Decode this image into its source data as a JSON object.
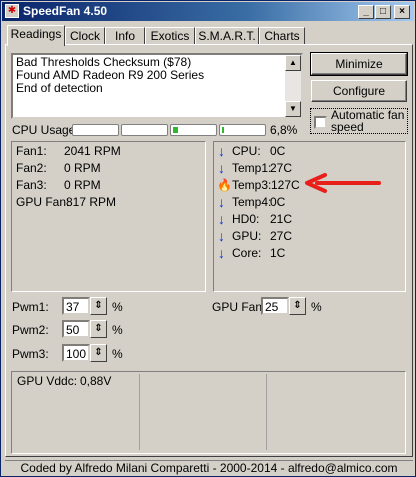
{
  "window": {
    "title": "SpeedFan 4.50",
    "minimize": "_",
    "maximize": "□",
    "close": "×"
  },
  "tabs": [
    {
      "label": "Readings"
    },
    {
      "label": "Clock"
    },
    {
      "label": "Info"
    },
    {
      "label": "Exotics"
    },
    {
      "label": "S.M.A.R.T."
    },
    {
      "label": "Charts"
    }
  ],
  "log": {
    "lines": [
      "Bad Thresholds Checksum ($78)",
      "Found AMD Radeon R9 200 Series",
      "End of detection"
    ]
  },
  "buttons": {
    "minimize": "Minimize",
    "configure": "Configure"
  },
  "auto_fan": {
    "label_line1": "Automatic fan",
    "label_line2": "speed",
    "checked": false
  },
  "cpu": {
    "label": "CPU Usage",
    "percent": "6,8%",
    "cores": [
      0,
      0,
      0.12,
      0.05
    ]
  },
  "fans": [
    {
      "label": "Fan1:",
      "value": "2041 RPM"
    },
    {
      "label": "Fan2:",
      "value": "0 RPM"
    },
    {
      "label": "Fan3:",
      "value": "0 RPM"
    },
    {
      "label": "GPU Fan:",
      "value": "817 RPM"
    }
  ],
  "temps": [
    {
      "label": "CPU:",
      "value": "0C",
      "icon": "arrow-down-icon"
    },
    {
      "label": "Temp1:",
      "value": "27C",
      "icon": "arrow-down-icon"
    },
    {
      "label": "Temp3:",
      "value": "127C",
      "icon": "flame-icon"
    },
    {
      "label": "Temp4:",
      "value": "0C",
      "icon": "arrow-down-icon"
    },
    {
      "label": "HD0:",
      "value": "21C",
      "icon": "arrow-down-icon"
    },
    {
      "label": "GPU:",
      "value": "27C",
      "icon": "arrow-down-icon"
    },
    {
      "label": "Core:",
      "value": "1C",
      "icon": "arrow-down-icon"
    }
  ],
  "pwm": [
    {
      "label": "Pwm1:",
      "value": "37",
      "unit": "%"
    },
    {
      "label": "Pwm2:",
      "value": "50",
      "unit": "%"
    },
    {
      "label": "Pwm3:",
      "value": "100",
      "unit": "%"
    }
  ],
  "gpu_fan": {
    "label": "GPU Fan:",
    "value": "25",
    "unit": "%"
  },
  "voltage": {
    "label": "GPU Vddc:",
    "value": "0,88V"
  },
  "status": "Coded by Alfredo Milani Comparetti - 2000-2014 - alfredo@almico.com",
  "colors": {
    "annotation_arrow": "#e8201c",
    "core_bar": "#2fb82f",
    "down_arrow": "#1030e0"
  }
}
